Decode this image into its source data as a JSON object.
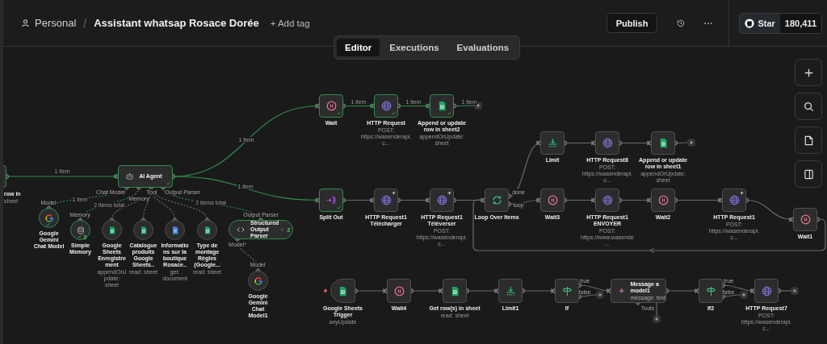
{
  "header": {
    "project": "Personal",
    "separator": "/",
    "title": "Assistant whatsap Rosace Dorée",
    "add_tag": "+ Add tag",
    "publish": "Publish",
    "star": "Star",
    "star_count": "180,411"
  },
  "tabs": [
    {
      "label": "Editor",
      "selected": true
    },
    {
      "label": "Executions",
      "selected": false
    },
    {
      "label": "Evaluations",
      "selected": false
    }
  ],
  "nodes": [
    {
      "kind": "box",
      "label": "row in",
      "subtitle": "sheet",
      "executed": true
    },
    {
      "kind": "wide",
      "label": "AI Agent",
      "executed": true
    },
    {
      "kind": "circle",
      "label": "Google Gemini Chat Model",
      "executed": true
    },
    {
      "kind": "circle",
      "label": "Simple Memory",
      "executed": true,
      "runs": "2"
    },
    {
      "kind": "circle",
      "label": "Google Sheets Enregistrement",
      "subtitle": "appendOrUpdate: sheet",
      "executed": false
    },
    {
      "kind": "circle",
      "label": "Catalogue produits Google Sheets..",
      "subtitle": "read: sheet",
      "executed": false
    },
    {
      "kind": "circle",
      "label": "Informations sur la boutique Rosace..",
      "subtitle": "get: document",
      "executed": false
    },
    {
      "kind": "circle",
      "label": "Type de montage Règles (Google...",
      "subtitle": "read: sheet",
      "executed": false
    },
    {
      "kind": "pill",
      "label": "Structured Output Parser",
      "executed": true,
      "runs": "2"
    },
    {
      "kind": "circle",
      "label": "Google Gemini Chat Model1",
      "executed": false
    },
    {
      "kind": "box",
      "label": "Wait",
      "executed": true
    },
    {
      "kind": "box",
      "label": "HTTP Request",
      "subtitle": "POST: https://wasenderapi.c...",
      "executed": true
    },
    {
      "kind": "box",
      "label": "Append or update row in sheet2",
      "subtitle": "appendOrUpdate: sheet",
      "executed": true
    },
    {
      "kind": "box",
      "label": "Split Out",
      "executed": true
    },
    {
      "kind": "box",
      "label": "HTTP Request1 Télécharger",
      "executed": false,
      "corner_plus": true
    },
    {
      "kind": "box",
      "label": "HTTP Request1 Téléverser",
      "subtitle": "POST: https://wasenderapi.c...",
      "executed": false,
      "corner_plus": true
    },
    {
      "kind": "box",
      "label": "Loop Over Items",
      "executed": false
    },
    {
      "kind": "box",
      "label": "Limit",
      "executed": false
    },
    {
      "kind": "box",
      "label": "HTTP Request8",
      "subtitle": "POST: https://wasenderapi.c...",
      "executed": false
    },
    {
      "kind": "box",
      "label": "Append or update row in sheet1",
      "subtitle": "appendOrUpdate: sheet",
      "executed": false
    },
    {
      "kind": "box",
      "label": "Wait3",
      "executed": false
    },
    {
      "kind": "box",
      "label": "HTTP Request1 ENVOYER",
      "subtitle": "POST: https://www.wasende...",
      "executed": false
    },
    {
      "kind": "box",
      "label": "Wait2",
      "executed": false
    },
    {
      "kind": "box",
      "label": "HTTP Request1",
      "subtitle": "POST: https://wasenderapi.c...",
      "executed": false,
      "corner_plus": true
    },
    {
      "kind": "box",
      "label": "Wait1",
      "executed": false
    },
    {
      "kind": "trigger",
      "label": "Google Sheets Trigger",
      "subtitle": "anyUpdate",
      "executed": false
    },
    {
      "kind": "box",
      "label": "Wait4",
      "executed": false
    },
    {
      "kind": "box",
      "label": "Get row(s) in sheet",
      "subtitle": "read: sheet",
      "executed": false
    },
    {
      "kind": "box",
      "label": "Limit1",
      "executed": false
    },
    {
      "kind": "box",
      "label": "If",
      "executed": false
    },
    {
      "kind": "wide",
      "label": "Message a model1",
      "subtitle": "message: text",
      "executed": false
    },
    {
      "kind": "box",
      "label": "If2",
      "executed": false
    },
    {
      "kind": "box",
      "label": "HTTP Request7",
      "subtitle": "POST: https://wasenderapi.c...",
      "executed": false
    }
  ],
  "edge_labels": [
    "1 item",
    "1 item",
    "1 item",
    "1 item",
    "1 item",
    "1 item",
    "1 item",
    "2 items total",
    "2 items total"
  ],
  "port_labels": [
    {
      "text": "Chat Model"
    },
    {
      "text": "Memory"
    },
    {
      "text": "Tool"
    },
    {
      "text": "Output Parser"
    },
    {
      "text": "Model"
    },
    {
      "text": "Memory"
    },
    {
      "text": "Output Parser"
    },
    {
      "text": "Model",
      "required_mark": "*"
    },
    {
      "text": "Model"
    },
    {
      "text": "done"
    },
    {
      "text": "loop"
    },
    {
      "text": "true"
    },
    {
      "text": "false"
    },
    {
      "text": "Tools"
    },
    {
      "text": "true"
    },
    {
      "text": "false"
    }
  ]
}
